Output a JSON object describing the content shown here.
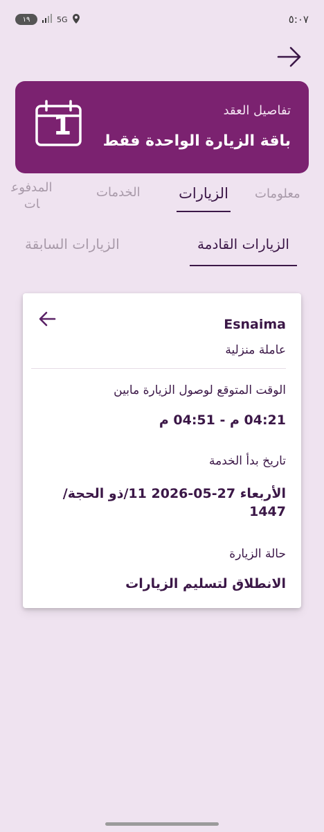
{
  "status_bar": {
    "time": "٥:٠٧",
    "battery": "١٩",
    "network": "5G"
  },
  "header": {
    "back_icon": "arrow-right-icon"
  },
  "contract": {
    "subtitle": "تفاصيل العقد",
    "title": "باقة الزيارة الواحدة فقط",
    "calendar_number": "1",
    "color": "#7b2270"
  },
  "main_tabs": [
    {
      "label": "معلومات"
    },
    {
      "label": "الزيارات"
    },
    {
      "label": "الخدمات"
    },
    {
      "label": "المدفوعات"
    }
  ],
  "sub_tabs": [
    {
      "label": "الزيارات القادمة"
    },
    {
      "label": "الزيارات السابقة"
    }
  ],
  "visit": {
    "name": "Esnaima",
    "role": "عاملة منزلية",
    "arrival_label": "الوقت المتوقع لوصول الزيارة مابين",
    "arrival_value": "04:21 م - 04:51 م",
    "start_label": "تاريخ بدأ الخدمة",
    "start_value_line1": "الأربعاء 27-05-2026 11/ذو الحجة/",
    "start_value_line2": "1447",
    "status_label": "حالة الزيارة",
    "status_value": "الانطلاق لتسليم الزيارات"
  }
}
